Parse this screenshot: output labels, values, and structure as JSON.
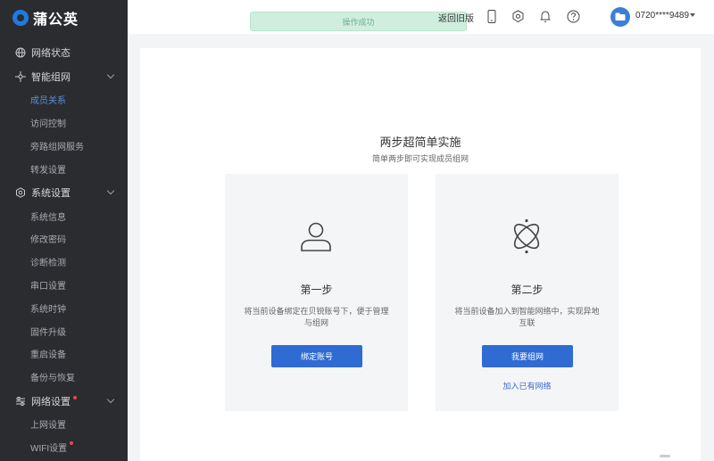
{
  "app": {
    "logo_text": "蒲公英"
  },
  "sidebar": {
    "groups": [
      {
        "label": "网络状态",
        "icon": "globe-icon",
        "items": []
      },
      {
        "label": "智能组网",
        "icon": "network-icon",
        "expanded": true,
        "items": [
          {
            "label": "成员关系",
            "active": true
          },
          {
            "label": "访问控制"
          },
          {
            "label": "旁路组网服务"
          },
          {
            "label": "转发设置"
          }
        ]
      },
      {
        "label": "系统设置",
        "icon": "settings-icon",
        "expanded": true,
        "items": [
          {
            "label": "系统信息"
          },
          {
            "label": "修改密码"
          },
          {
            "label": "诊断检测"
          },
          {
            "label": "串口设置"
          },
          {
            "label": "系统时钟"
          },
          {
            "label": "固件升级"
          },
          {
            "label": "重启设备"
          },
          {
            "label": "备份与恢复"
          }
        ]
      },
      {
        "label": "网络设置",
        "icon": "sliders-icon",
        "expanded": true,
        "badge": true,
        "items": [
          {
            "label": "上网设置"
          },
          {
            "label": "WIFI设置",
            "badge": true
          }
        ]
      }
    ]
  },
  "header": {
    "toast": "操作成功",
    "back_link": "返回旧版",
    "user": "0720****9489",
    "status_color": "#e5484d",
    "accent_color": "#2f6bd3"
  },
  "main": {
    "title": "两步超简单实施",
    "subtitle": "简单两步即可实现成员组网",
    "cards": [
      {
        "title": "第一步",
        "desc": "将当前设备绑定在贝锐账号下，便于管理与组网",
        "button": "绑定账号",
        "link": ""
      },
      {
        "title": "第二步",
        "desc": "将当前设备加入到智能网络中，实现异地互联",
        "button": "我要组网",
        "link": "加入已有网络"
      }
    ]
  }
}
